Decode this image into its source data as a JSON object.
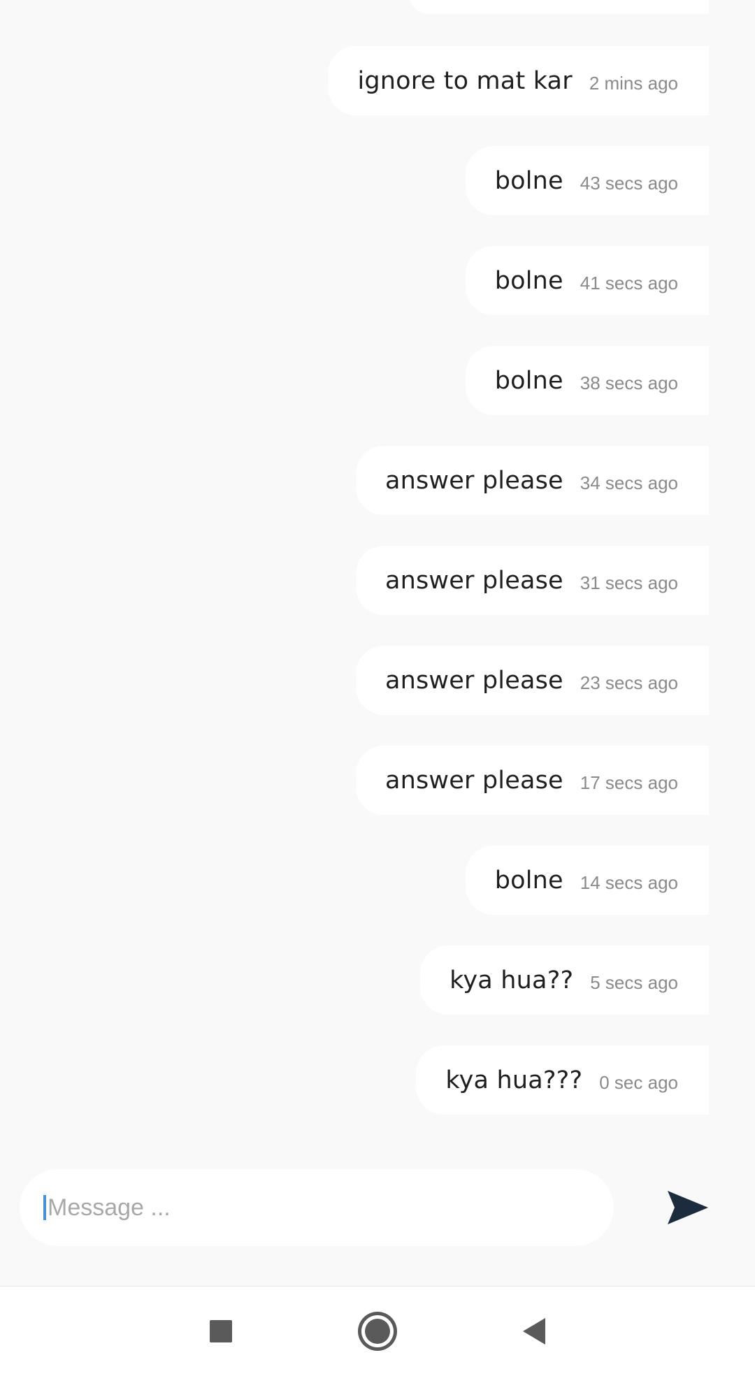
{
  "messages": [
    {
      "text": "ignore to mat kar",
      "time": "2 mins ago"
    },
    {
      "text": "bolne",
      "time": "43 secs ago"
    },
    {
      "text": "bolne",
      "time": "41 secs ago"
    },
    {
      "text": "bolne",
      "time": "38 secs ago"
    },
    {
      "text": "answer please",
      "time": "34 secs ago"
    },
    {
      "text": "answer please",
      "time": "31 secs ago"
    },
    {
      "text": "answer please",
      "time": "23 secs ago"
    },
    {
      "text": "answer please",
      "time": "17 secs ago"
    },
    {
      "text": "bolne",
      "time": "14 secs ago"
    },
    {
      "text": "kya hua??",
      "time": "5 secs ago"
    },
    {
      "text": "kya hua???",
      "time": "0 sec ago"
    }
  ],
  "composer": {
    "placeholder": "Message ...",
    "value": ""
  },
  "icons": {
    "send": "send-icon",
    "recents": "recents-icon",
    "home": "home-icon",
    "back": "back-icon"
  },
  "colors": {
    "background": "#f9f9f9",
    "bubble": "#ffffff",
    "send_icon": "#1d2b3f",
    "caret": "#4a90d9"
  }
}
